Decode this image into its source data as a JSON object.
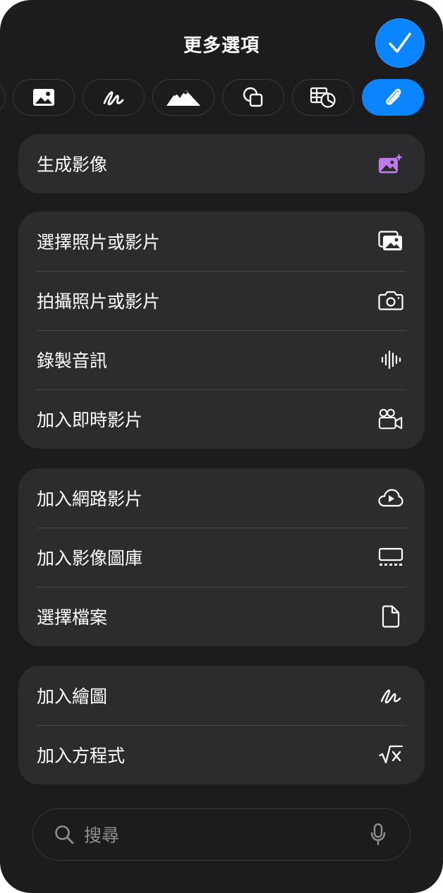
{
  "header": {
    "title": "更多選項"
  },
  "colors": {
    "accent": "#0a84ff",
    "generate_icon": "#bf7af0",
    "panel": "#2c2c2e",
    "background": "#1c1c1e"
  },
  "tabs": [
    {
      "icon": "photo-icon"
    },
    {
      "icon": "scribble-icon"
    },
    {
      "icon": "mountains-icon"
    },
    {
      "icon": "shapes-icon"
    },
    {
      "icon": "chart-table-icon"
    },
    {
      "icon": "paperclip-icon",
      "selected": true
    }
  ],
  "groups": [
    {
      "items": [
        {
          "label": "生成影像",
          "icon": "image-sparkle-icon"
        }
      ]
    },
    {
      "items": [
        {
          "label": "選擇照片或影片",
          "icon": "photo-library-icon"
        },
        {
          "label": "拍攝照片或影片",
          "icon": "camera-icon"
        },
        {
          "label": "錄製音訊",
          "icon": "waveform-icon"
        },
        {
          "label": "加入即時影片",
          "icon": "video-camera-icon"
        }
      ]
    },
    {
      "items": [
        {
          "label": "加入網路影片",
          "icon": "cloud-play-icon"
        },
        {
          "label": "加入影像圖庫",
          "icon": "gallery-icon"
        },
        {
          "label": "選擇檔案",
          "icon": "document-icon"
        }
      ]
    },
    {
      "items": [
        {
          "label": "加入繪圖",
          "icon": "scribble-icon"
        },
        {
          "label": "加入方程式",
          "icon": "square-root-icon"
        }
      ]
    }
  ],
  "search": {
    "placeholder": "搜尋"
  }
}
